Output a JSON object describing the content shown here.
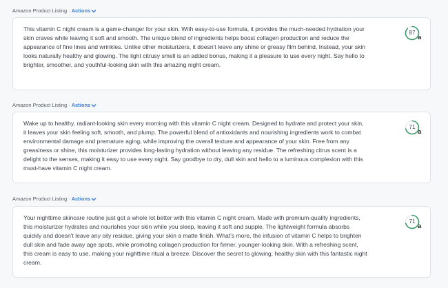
{
  "listings": [
    {
      "label": "Amazon Product Listing",
      "separator": "·",
      "actions_label": "Actions",
      "text": "This vitamin C night cream is a game-changer for your skin. With easy-to-use formula, it provides the much-needed hydration your skin craves while leaving it soft and smooth. The unique blend of ingredients helps boost collagen production and reduce the appearance of fine lines and wrinkles. Unlike other moisturizers, it doesn't leave any shine or greasy film behind. Instead, your skin looks naturally healthy and glowing. The light citrusy smell is an added bonus, making it a pleasure to use every night. Say hello to brighter, smoother, and youthful-looking skin with this amazing night cream.",
      "score": "87",
      "score_value": 87,
      "grade": "a",
      "score_color": "#3e9a6a"
    },
    {
      "label": "Amazon Product Listing",
      "separator": "·",
      "actions_label": "Actions",
      "text": "Wake up to healthy, radiant-looking skin every morning with this vitamin C night cream. Designed to hydrate and protect your skin, it leaves your skin feeling soft, smooth, and plump. The powerful blend of antioxidants and nourishing ingredients work to combat environmental damage and premature aging, while improving the overall texture and appearance of your skin. Free from any greasiness or shine, this moisturizer provides long-lasting hydration without leaving any residue. The refreshing citrus scent is a delight to the senses, making it easy to use every night. Say goodbye to dry, dull skin and hello to a luminous complexion with this must-have vitamin C night cream.",
      "score": "71",
      "score_value": 71,
      "grade": "a",
      "score_color": "#3e9a6a"
    },
    {
      "label": "Amazon Product Listing",
      "separator": "·",
      "actions_label": "Actions",
      "text": "Your nighttime skincare routine just got a whole lot better with this vitamin C night cream. Made with premium-quality ingredients, this moisturizer hydrates and nourishes your skin while you sleep, leaving it soft and supple. The lightweight formula absorbs quickly and doesn't leave any oily residue, giving your skin a matte finish. What's more, the infusion of vitamin C helps to brighten dull skin and fade away age spots, while promoting collagen production for firmer, younger-looking skin. With a refreshing scent, this cream is easy to use, making your nighttime ritual a breeze. Discover the secret to glowing, healthy skin with this fantastic night cream.",
      "score": "71",
      "score_value": 71,
      "grade": "a",
      "score_color": "#3e9a6a"
    }
  ],
  "icons": {
    "actions_chevron": "chevron-down-icon",
    "score_ring": "score-ring-icon"
  }
}
